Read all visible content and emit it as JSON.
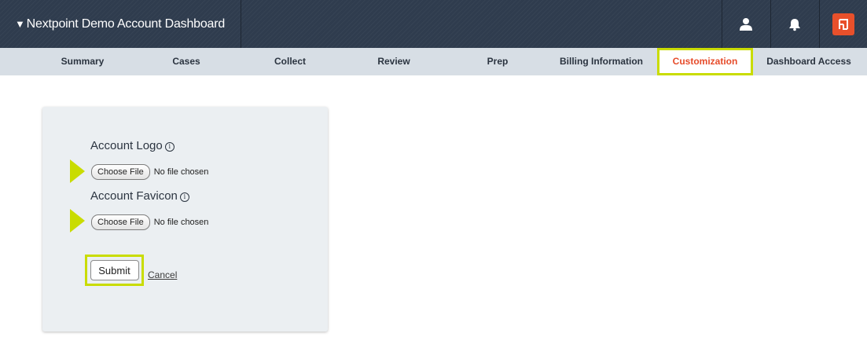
{
  "header": {
    "caret": "▼",
    "title": "Nextpoint Demo Account Dashboard",
    "icons": [
      "user-icon",
      "bell-icon",
      "nextpoint-logo-icon"
    ],
    "logo_color": "#e8502b"
  },
  "nav": {
    "items": [
      {
        "label": "Summary"
      },
      {
        "label": "Cases"
      },
      {
        "label": "Collect"
      },
      {
        "label": "Review"
      },
      {
        "label": "Prep"
      },
      {
        "label": "Billing Information"
      },
      {
        "label": "Customization",
        "active": true
      },
      {
        "label": "Dashboard Access"
      }
    ],
    "active_color": "#e64b2a",
    "highlight_color": "#c9dc00"
  },
  "form": {
    "logo_label": "Account Logo",
    "logo_info": "i",
    "logo_choose": "Choose File",
    "logo_status": "No file chosen",
    "favicon_label": "Account Favicon",
    "favicon_info": "i",
    "favicon_choose": "Choose File",
    "favicon_status": "No file chosen",
    "submit_label": "Submit",
    "cancel_label": "Cancel"
  }
}
